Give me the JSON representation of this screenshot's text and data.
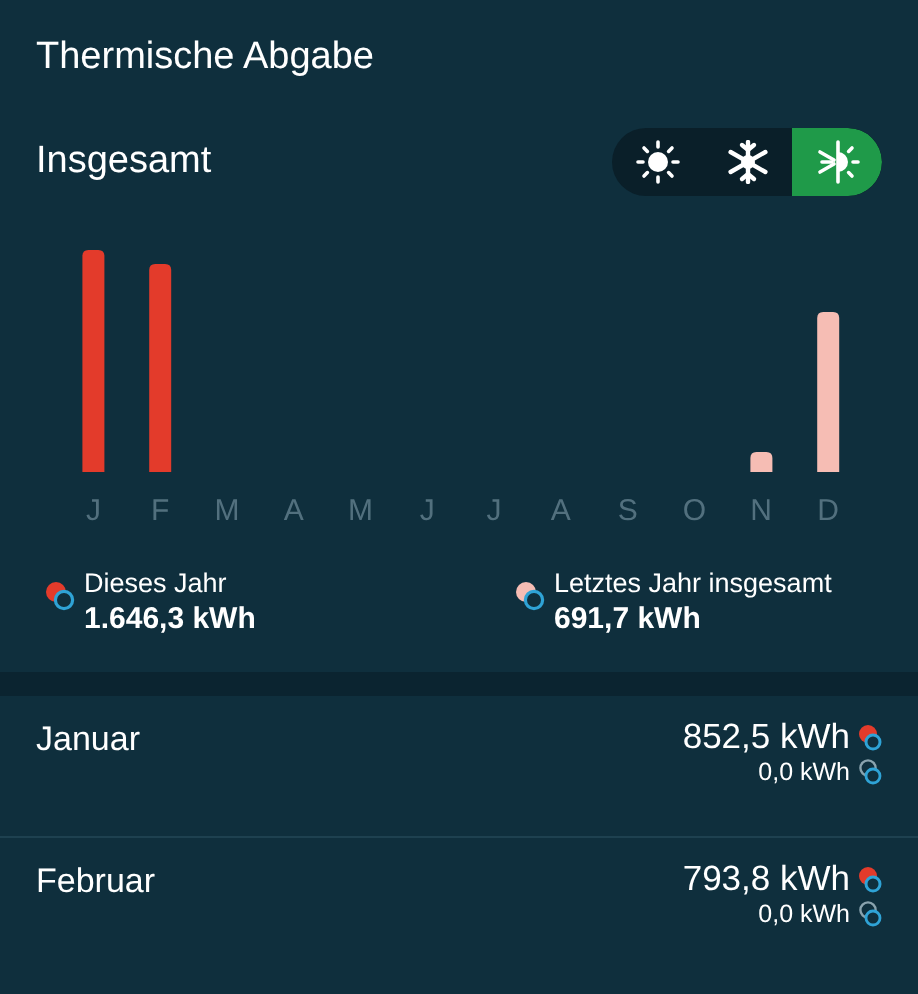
{
  "title": "Thermische Abgabe",
  "section": {
    "title": "Insgesamt"
  },
  "mode_toggle": [
    {
      "kind": "sun",
      "selected": false
    },
    {
      "kind": "snow",
      "selected": false
    },
    {
      "kind": "both",
      "selected": true
    }
  ],
  "chart": {
    "months": [
      "J",
      "F",
      "M",
      "A",
      "M",
      "J",
      "J",
      "A",
      "S",
      "O",
      "N",
      "D"
    ]
  },
  "legend": [
    {
      "kind": "current",
      "label": "Dieses Jahr",
      "value": "1.646,3 kWh"
    },
    {
      "kind": "previous",
      "label": "Letztes Jahr insgesamt",
      "value": "691,7 kWh"
    }
  ],
  "months": [
    {
      "name": "Januar",
      "heat": "852,5 kWh",
      "cool": "0,0 kWh"
    },
    {
      "name": "Februar",
      "heat": "793,8 kWh",
      "cool": "0,0 kWh"
    }
  ]
}
